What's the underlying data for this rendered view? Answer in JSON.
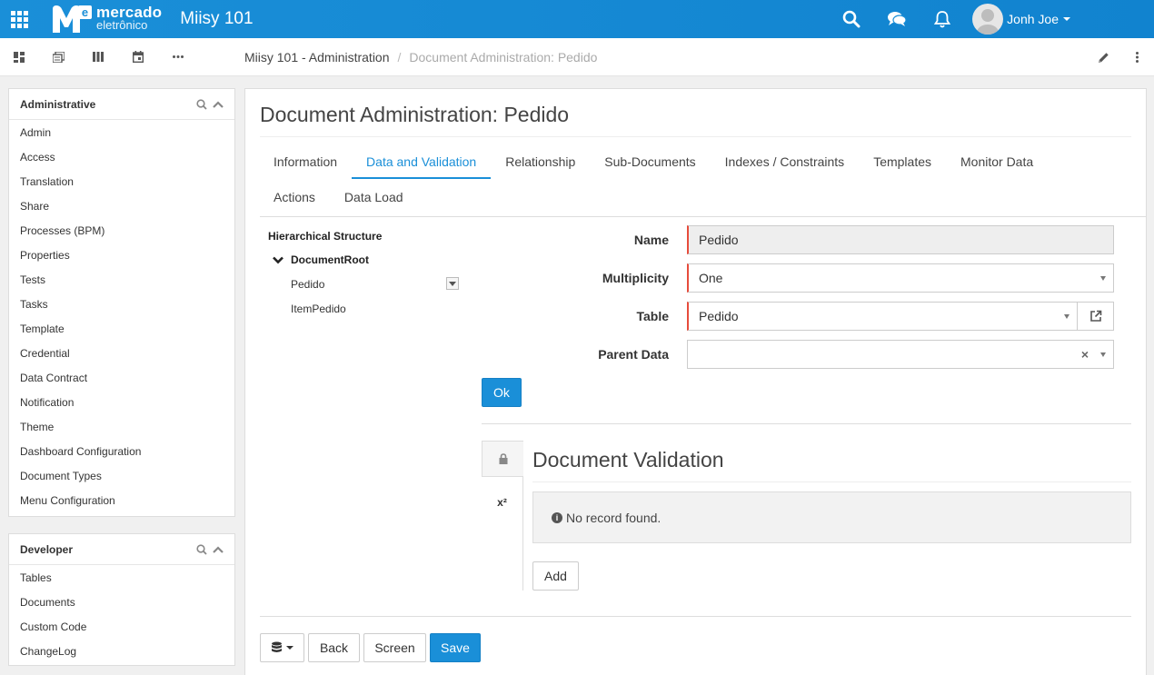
{
  "app": {
    "logo_line1": "mercado",
    "logo_line2": "eletrônico",
    "logo_letter": "e",
    "title": "Miisy 101",
    "brand_color": "#1a8fd8",
    "icons": [
      "apps-grid-icon",
      "search-icon",
      "chat-icon",
      "bell-icon"
    ]
  },
  "user": {
    "name": "Jonh Joe"
  },
  "toolbar": {
    "left_icons": [
      "dashboard-icon",
      "documents-icon",
      "columns-icon",
      "calendar-icon",
      "more-horizontal-icon"
    ],
    "right_icons": [
      "pencil-icon",
      "more-vertical-icon"
    ]
  },
  "breadcrumb": {
    "parent": "Miisy 101 - Administration",
    "separator": "/",
    "current": "Document Administration: Pedido"
  },
  "sidebar": {
    "administrative": {
      "title": "Administrative",
      "items": [
        "Admin",
        "Access",
        "Translation",
        "Share",
        "Processes (BPM)",
        "Properties",
        "Tests",
        "Tasks",
        "Template",
        "Credential",
        "Data Contract",
        "Notification",
        "Theme",
        "Dashboard Configuration",
        "Document Types",
        "Menu Configuration"
      ]
    },
    "developer": {
      "title": "Developer",
      "items": [
        "Tables",
        "Documents",
        "Custom Code",
        "ChangeLog"
      ]
    }
  },
  "page": {
    "title": "Document Administration: Pedido",
    "tabs_row1": [
      "Information",
      "Data and Validation",
      "Relationship",
      "Sub-Documents",
      "Indexes / Constraints",
      "Templates",
      "Monitor Data"
    ],
    "tabs_row2": [
      "Actions",
      "Data Load"
    ],
    "active_tab": "Data and Validation"
  },
  "tree": {
    "title": "Hierarchical Structure",
    "root": "DocumentRoot",
    "children": [
      "Pedido",
      "ItemPedido"
    ]
  },
  "form": {
    "name_label": "Name",
    "name_value": "Pedido",
    "multiplicity_label": "Multiplicity",
    "multiplicity_value": "One",
    "table_label": "Table",
    "table_value": "Pedido",
    "parent_label": "Parent Data",
    "parent_value": "",
    "clear_symbol": "×",
    "ok_label": "Ok"
  },
  "validation": {
    "superscript_tab": "x²",
    "title": "Document Validation",
    "empty_message": "No record found.",
    "add_label": "Add"
  },
  "bottom_bar": {
    "back_label": "Back",
    "screen_label": "Screen",
    "save_label": "Save"
  }
}
